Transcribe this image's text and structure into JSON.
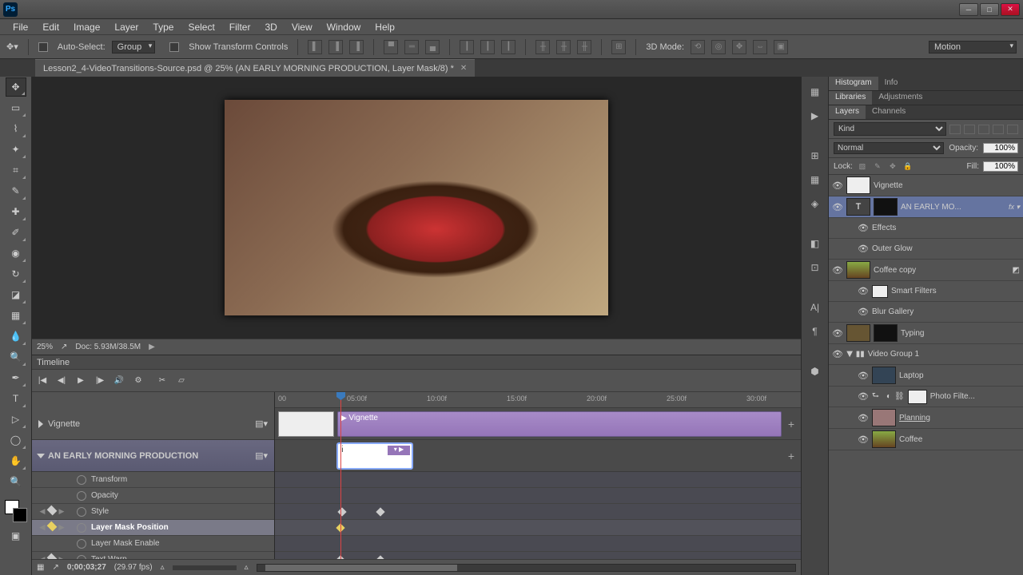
{
  "menu": [
    "File",
    "Edit",
    "Image",
    "Layer",
    "Type",
    "Select",
    "Filter",
    "3D",
    "View",
    "Window",
    "Help"
  ],
  "options": {
    "auto_select_label": "Auto-Select:",
    "auto_select_value": "Group",
    "show_transform": "Show Transform Controls",
    "mode3d": "3D Mode:",
    "workspace": "Motion"
  },
  "doc": {
    "tab_title": "Lesson2_4-VideoTransitions-Source.psd @ 25% (AN EARLY MORNING PRODUCTION, Layer Mask/8) *"
  },
  "status": {
    "zoom": "25%",
    "doc": "Doc: 5.93M/38.5M"
  },
  "timeline": {
    "title": "Timeline",
    "ruler": [
      "00",
      "05:00f",
      "10:00f",
      "15:00f",
      "20:00f",
      "25:00f",
      "30:00f"
    ],
    "track1": "Vignette",
    "clip_vignette": "Vignette",
    "track2": "AN EARLY MORNING PRODUCTION",
    "props": [
      "Transform",
      "Opacity",
      "Style",
      "Layer Mask Position",
      "Layer Mask Enable",
      "Text Warp"
    ],
    "time": "0;00;03;27",
    "fps": "(29.97 fps)"
  },
  "panels": {
    "hist": [
      "Histogram",
      "Info"
    ],
    "lib": [
      "Libraries",
      "Adjustments"
    ],
    "lay": [
      "Layers",
      "Channels"
    ],
    "filter_kind": "Kind",
    "blend": "Normal",
    "opacity_label": "Opacity:",
    "opacity": "100%",
    "lock_label": "Lock:",
    "fill_label": "Fill:",
    "fill": "100%"
  },
  "layers": {
    "vignette": "Vignette",
    "early": "AN EARLY MO...",
    "effects": "Effects",
    "outer_glow": "Outer Glow",
    "coffee_copy": "Coffee copy",
    "smart_filters": "Smart Filters",
    "blur_gallery": "Blur Gallery",
    "typing": "Typing",
    "video_group": "Video Group 1",
    "laptop": "Laptop",
    "photo_filter": "Photo Filte...",
    "planning": "Planning ",
    "coffee": "Coffee"
  }
}
